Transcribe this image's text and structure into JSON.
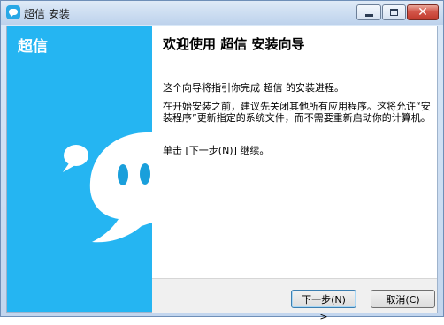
{
  "window": {
    "title": "超信 安装",
    "accent": "#25b5f2"
  },
  "sidebar": {
    "title": "超信"
  },
  "content": {
    "heading": "欢迎使用 超信 安装向导",
    "paragraphs": [
      "这个向导将指引你完成 超信 的安装进程。",
      "在开始安装之前，建议先关闭其他所有应用程序。这将允许“安装程序”更新指定的系统文件，而不需要重新启动你的计算机。",
      "单击 [下一步(N)] 继续。"
    ]
  },
  "buttons": {
    "next": "下一步(N) >",
    "cancel": "取消(C)"
  },
  "icons": {
    "app": "app-chat-icon",
    "minimize": "minimize-icon",
    "maximize": "maximize-icon",
    "close": "close-icon"
  }
}
